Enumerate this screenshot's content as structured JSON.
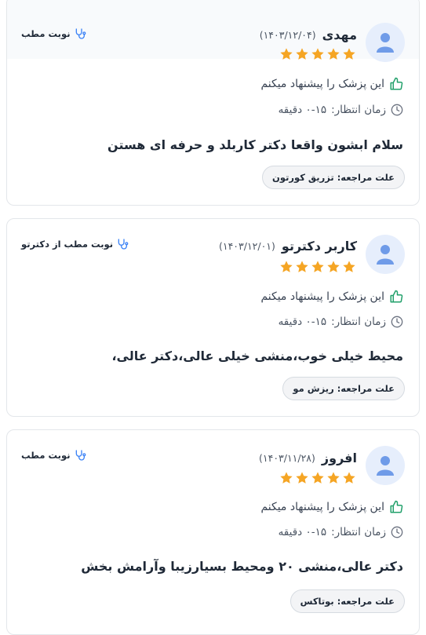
{
  "reviews": [
    {
      "name": "مهدی",
      "date": "(۱۴۰۳/۱۲/۰۴)",
      "rating": 5,
      "visit_type": "نوبت مطب",
      "recommend": "این پزشک را پیشنهاد میکنم",
      "wait_label": "زمان انتظار:",
      "wait_value": "۰-۱۵ دقیقه",
      "comment": "سلام ابشون واقعا دکتر کاربلد و حرفه ای هستن",
      "reason_label": "علت مراجعه:",
      "reason_value": "تزریق کورتون"
    },
    {
      "name": "کاربر دکترتو",
      "date": "(۱۴۰۳/۱۲/۰۱)",
      "rating": 5,
      "visit_type": "نوبت مطب از دکترتو",
      "recommend": "این پزشک را پیشنهاد میکنم",
      "wait_label": "زمان انتظار:",
      "wait_value": "۰-۱۵ دقیقه",
      "comment": "محیط خیلی خوب،منشی خیلی عالی،دکتر عالی،",
      "reason_label": "علت مراجعه:",
      "reason_value": "ریزش مو"
    },
    {
      "name": "افروز",
      "date": "(۱۴۰۳/۱۱/۲۸)",
      "rating": 5,
      "visit_type": "نوبت مطب",
      "recommend": "این پزشک را پیشنهاد میکنم",
      "wait_label": "زمان انتظار:",
      "wait_value": "۰-۱۵ دقیقه",
      "comment": "دکتر عالی،منشی ۲۰ ومحیط بسیارزیبا وآرامش بخش",
      "reason_label": "علت مراجعه:",
      "reason_value": "بوتاکس"
    }
  ],
  "colors": {
    "star": "#f5a524",
    "thumb": "#22a06b",
    "avatar_bg": "#e6eefc",
    "avatar_fg": "#6f9be8",
    "stethoscope": "#3b82f6"
  },
  "icons": {
    "avatar": "user-icon",
    "star": "star-icon",
    "visit": "stethoscope-icon",
    "recommend": "thumbs-up-icon",
    "wait": "clock-icon"
  }
}
